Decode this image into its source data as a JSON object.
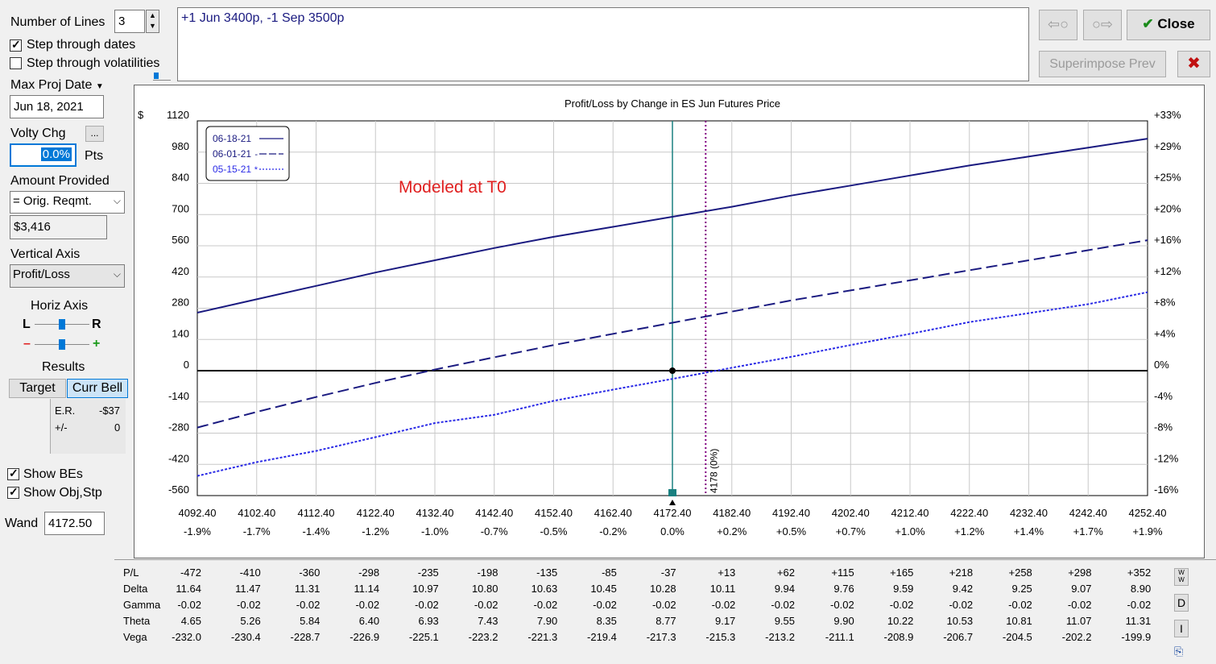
{
  "controls": {
    "num_lines_label": "Number of Lines",
    "num_lines_value": "3",
    "step_dates_label": "Step through dates",
    "step_vols_label": "Step through volatilities",
    "max_proj_date_label": "Max Proj Date",
    "max_proj_date_value": "Jun 18, 2021",
    "volty_chg_label": "Volty Chg",
    "volty_chg_button": "...",
    "volty_chg_value": "0.0%",
    "volty_unit": "Pts",
    "amount_provided_label": "Amount Provided",
    "amount_provided_option": "= Orig. Reqmt.",
    "amount_value": "$3,416",
    "vertical_axis_label": "Vertical Axis",
    "vertical_axis_option": "Profit/Loss",
    "horiz_axis_label": "Horiz Axis",
    "horiz_l": "L",
    "horiz_r": "R",
    "horiz_minus": "–",
    "horiz_plus": "+",
    "results_label": "Results",
    "target_tab": "Target",
    "curr_bell_tab": "Curr Bell",
    "er_label": "E.R.",
    "er_value": "-$37",
    "pm_label": "+/-",
    "pm_value": "0",
    "show_bes_label": "Show BEs",
    "show_obj_label": "Show Obj,Stp",
    "wand_label": "Wand",
    "wand_value": "4172.50"
  },
  "position_text": "+1 Jun 3400p, -1 Sep 3500p",
  "buttons": {
    "prev_arrow": "⇦○",
    "next_arrow": "○⇨",
    "close": "Close",
    "close_check": "✔",
    "superimpose": "Superimpose Prev",
    "cancel_x": "✖"
  },
  "chart_data": {
    "type": "line",
    "title": "Profit/Loss by Change in ES Jun Futures Price",
    "ylabel": "$",
    "annotation": "Modeled at T0",
    "wand_marker": "4178 (0%)",
    "x_ticks": [
      "4092.40",
      "4102.40",
      "4112.40",
      "4122.40",
      "4132.40",
      "4142.40",
      "4152.40",
      "4162.40",
      "4172.40",
      "4182.40",
      "4192.40",
      "4202.40",
      "4212.40",
      "4222.40",
      "4232.40",
      "4242.40",
      "4252.40"
    ],
    "x_pct_ticks": [
      "-1.9%",
      "-1.7%",
      "-1.4%",
      "-1.2%",
      "-1.0%",
      "-0.7%",
      "-0.5%",
      "-0.2%",
      "0.0%",
      "+0.2%",
      "+0.5%",
      "+0.7%",
      "+1.0%",
      "+1.2%",
      "+1.4%",
      "+1.7%",
      "+1.9%"
    ],
    "y_ticks": [
      "1120",
      "980",
      "840",
      "700",
      "560",
      "420",
      "280",
      "140",
      "0",
      "-140",
      "-280",
      "-420",
      "-560"
    ],
    "y_right_ticks": [
      "+33%",
      "+29%",
      "+25%",
      "+20%",
      "+16%",
      "+12%",
      "+8%",
      "+4%",
      "0%",
      "-4%",
      "-8%",
      "-12%",
      "-16%"
    ],
    "xlim": [
      4092.4,
      4252.4
    ],
    "ylim": [
      -560,
      1120
    ],
    "current_price": 4172.4,
    "breakeven": 4178,
    "series": [
      {
        "name": "06-18-21",
        "style": "solid",
        "color": "#1a1a80",
        "x": [
          4092.4,
          4102.4,
          4112.4,
          4122.4,
          4132.4,
          4142.4,
          4152.4,
          4162.4,
          4172.4,
          4182.4,
          4192.4,
          4202.4,
          4212.4,
          4222.4,
          4232.4,
          4242.4,
          4252.4
        ],
        "y": [
          260,
          320,
          380,
          440,
          495,
          550,
          600,
          645,
          690,
          735,
          785,
          830,
          875,
          920,
          960,
          1000,
          1040
        ]
      },
      {
        "name": "06-01-21",
        "style": "dashed",
        "color": "#1a1a80",
        "x": [
          4092.4,
          4102.4,
          4112.4,
          4122.4,
          4132.4,
          4142.4,
          4152.4,
          4162.4,
          4172.4,
          4182.4,
          4192.4,
          4202.4,
          4212.4,
          4222.4,
          4232.4,
          4242.4,
          4252.4
        ],
        "y": [
          -255,
          -185,
          -118,
          -55,
          5,
          60,
          115,
          165,
          215,
          265,
          315,
          360,
          405,
          450,
          495,
          540,
          585
        ]
      },
      {
        "name": "05-15-21",
        "style": "dotted",
        "color": "#2a2ae6",
        "x": [
          4092.4,
          4102.4,
          4112.4,
          4122.4,
          4132.4,
          4142.4,
          4152.4,
          4162.4,
          4172.4,
          4182.4,
          4192.4,
          4202.4,
          4212.4,
          4222.4,
          4232.4,
          4242.4,
          4252.4
        ],
        "y": [
          -472,
          -410,
          -360,
          -298,
          -235,
          -198,
          -135,
          -85,
          -37,
          13,
          62,
          115,
          165,
          218,
          258,
          298,
          352
        ]
      }
    ],
    "legend_suffixes": [
      "",
      "-",
      "*"
    ],
    "grid": true,
    "legend_position": "top-left"
  },
  "greeks": {
    "rows": [
      {
        "label": "P/L",
        "values": [
          "-472",
          "-410",
          "-360",
          "-298",
          "-235",
          "-198",
          "-135",
          "-85",
          "-37",
          "+13",
          "+62",
          "+115",
          "+165",
          "+218",
          "+258",
          "+298",
          "+352"
        ]
      },
      {
        "label": "Delta",
        "values": [
          "11.64",
          "11.47",
          "11.31",
          "11.14",
          "10.97",
          "10.80",
          "10.63",
          "10.45",
          "10.28",
          "10.11",
          "9.94",
          "9.76",
          "9.59",
          "9.42",
          "9.25",
          "9.07",
          "8.90"
        ]
      },
      {
        "label": "Gamma",
        "values": [
          "-0.02",
          "-0.02",
          "-0.02",
          "-0.02",
          "-0.02",
          "-0.02",
          "-0.02",
          "-0.02",
          "-0.02",
          "-0.02",
          "-0.02",
          "-0.02",
          "-0.02",
          "-0.02",
          "-0.02",
          "-0.02",
          "-0.02"
        ]
      },
      {
        "label": "Theta",
        "values": [
          "4.65",
          "5.26",
          "5.84",
          "6.40",
          "6.93",
          "7.43",
          "7.90",
          "8.35",
          "8.77",
          "9.17",
          "9.55",
          "9.90",
          "10.22",
          "10.53",
          "10.81",
          "11.07",
          "11.31"
        ]
      },
      {
        "label": "Vega",
        "values": [
          "-232.0",
          "-230.4",
          "-228.7",
          "-226.9",
          "-225.1",
          "-223.2",
          "-221.3",
          "-219.4",
          "-217.3",
          "-215.3",
          "-213.2",
          "-211.1",
          "-208.9",
          "-206.7",
          "-204.5",
          "-202.2",
          "-199.9"
        ]
      }
    ],
    "side_buttons": [
      "W",
      "D",
      "I"
    ]
  },
  "colors": {
    "wand_line": "#1a8080",
    "be_line": "#800080",
    "annotation": "#e02020",
    "accent": "#0078d7"
  }
}
